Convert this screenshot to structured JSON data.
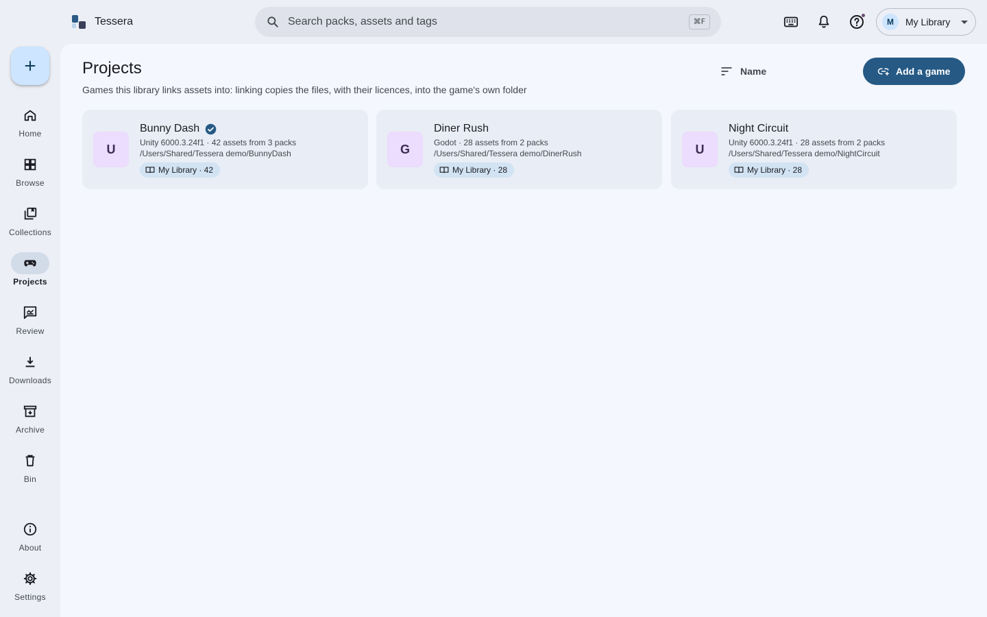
{
  "app": {
    "name": "Tessera"
  },
  "search": {
    "placeholder": "Search packs, assets and tags",
    "shortcut": "⌘F"
  },
  "account": {
    "initial": "M",
    "label": "My Library"
  },
  "nav": {
    "items": [
      {
        "label": "Home"
      },
      {
        "label": "Browse"
      },
      {
        "label": "Collections"
      },
      {
        "label": "Projects",
        "active": true
      },
      {
        "label": "Review"
      },
      {
        "label": "Downloads"
      },
      {
        "label": "Archive"
      },
      {
        "label": "Bin"
      },
      {
        "label": "About"
      },
      {
        "label": "Settings"
      }
    ]
  },
  "page": {
    "title": "Projects",
    "subtitle": "Games this library links assets into: linking copies the files, with their licences, into the game's own folder",
    "sort_label": "Name",
    "add_label": "Add a game"
  },
  "projects": [
    {
      "initial": "U",
      "name": "Bunny Dash",
      "verified": true,
      "meta": "Unity 6000.3.24f1 · 42 assets from 3 packs",
      "path": "/Users/Shared/Tessera demo/BunnyDash",
      "chip": "My Library · 42"
    },
    {
      "initial": "G",
      "name": "Diner Rush",
      "verified": false,
      "meta": "Godot · 28 assets from 2 packs",
      "path": "/Users/Shared/Tessera demo/DinerRush",
      "chip": "My Library · 28"
    },
    {
      "initial": "U",
      "name": "Night Circuit",
      "verified": false,
      "meta": "Unity 6000.3.24f1 · 28 assets from 2 packs",
      "path": "/Users/Shared/Tessera demo/NightCircuit",
      "chip": "My Library · 28"
    }
  ],
  "colors": {
    "accent": "#265a85",
    "fab": "#cde5ff",
    "tile": "#ecdcfd",
    "chip": "#d2e3f3",
    "verified": "#265a85"
  }
}
